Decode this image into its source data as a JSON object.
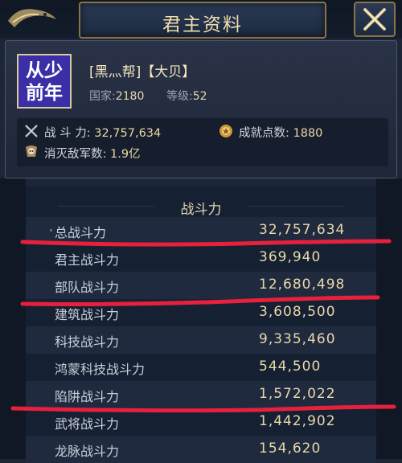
{
  "window": {
    "title": "君主资料"
  },
  "profile": {
    "avatar_text": "从少前年",
    "avatar_line1": "从少",
    "avatar_line2": "前年",
    "name": "[黑灬帮]【大贝】",
    "country_label": "国家:",
    "country_value": "2180",
    "level_label": "等级:",
    "level_value": "52",
    "power_label": "战  斗  力:",
    "power_value": "32,757,634",
    "achievement_label": "成就点数:",
    "achievement_value": "1880",
    "kills_label": "消灭敌军数:",
    "kills_value": "1.9亿"
  },
  "combat": {
    "title": "战斗力",
    "rows": [
      {
        "label": "总战斗力",
        "value": "32,757,634"
      },
      {
        "label": "君主战斗力",
        "value": "369,940"
      },
      {
        "label": "部队战斗力",
        "value": "12,680,498"
      },
      {
        "label": "建筑战斗力",
        "value": "3,608,500"
      },
      {
        "label": "科技战斗力",
        "value": "9,335,460"
      },
      {
        "label": "鸿蒙科技战斗力",
        "value": "544,500"
      },
      {
        "label": "陷阱战斗力",
        "value": "1,572,022"
      },
      {
        "label": "武将战斗力",
        "value": "1,442,902"
      },
      {
        "label": "龙脉战斗力",
        "value": "154,620"
      }
    ]
  },
  "icons": {
    "back": "dragon-back-icon",
    "close": "close-icon",
    "power": "crossed-swords-icon",
    "achievement": "medal-icon",
    "kills": "skull-icon"
  },
  "colors": {
    "accent_gold": "#e9d9a8",
    "avatar_bg": "#3a2fa6",
    "annotation_red": "#e8203c"
  }
}
